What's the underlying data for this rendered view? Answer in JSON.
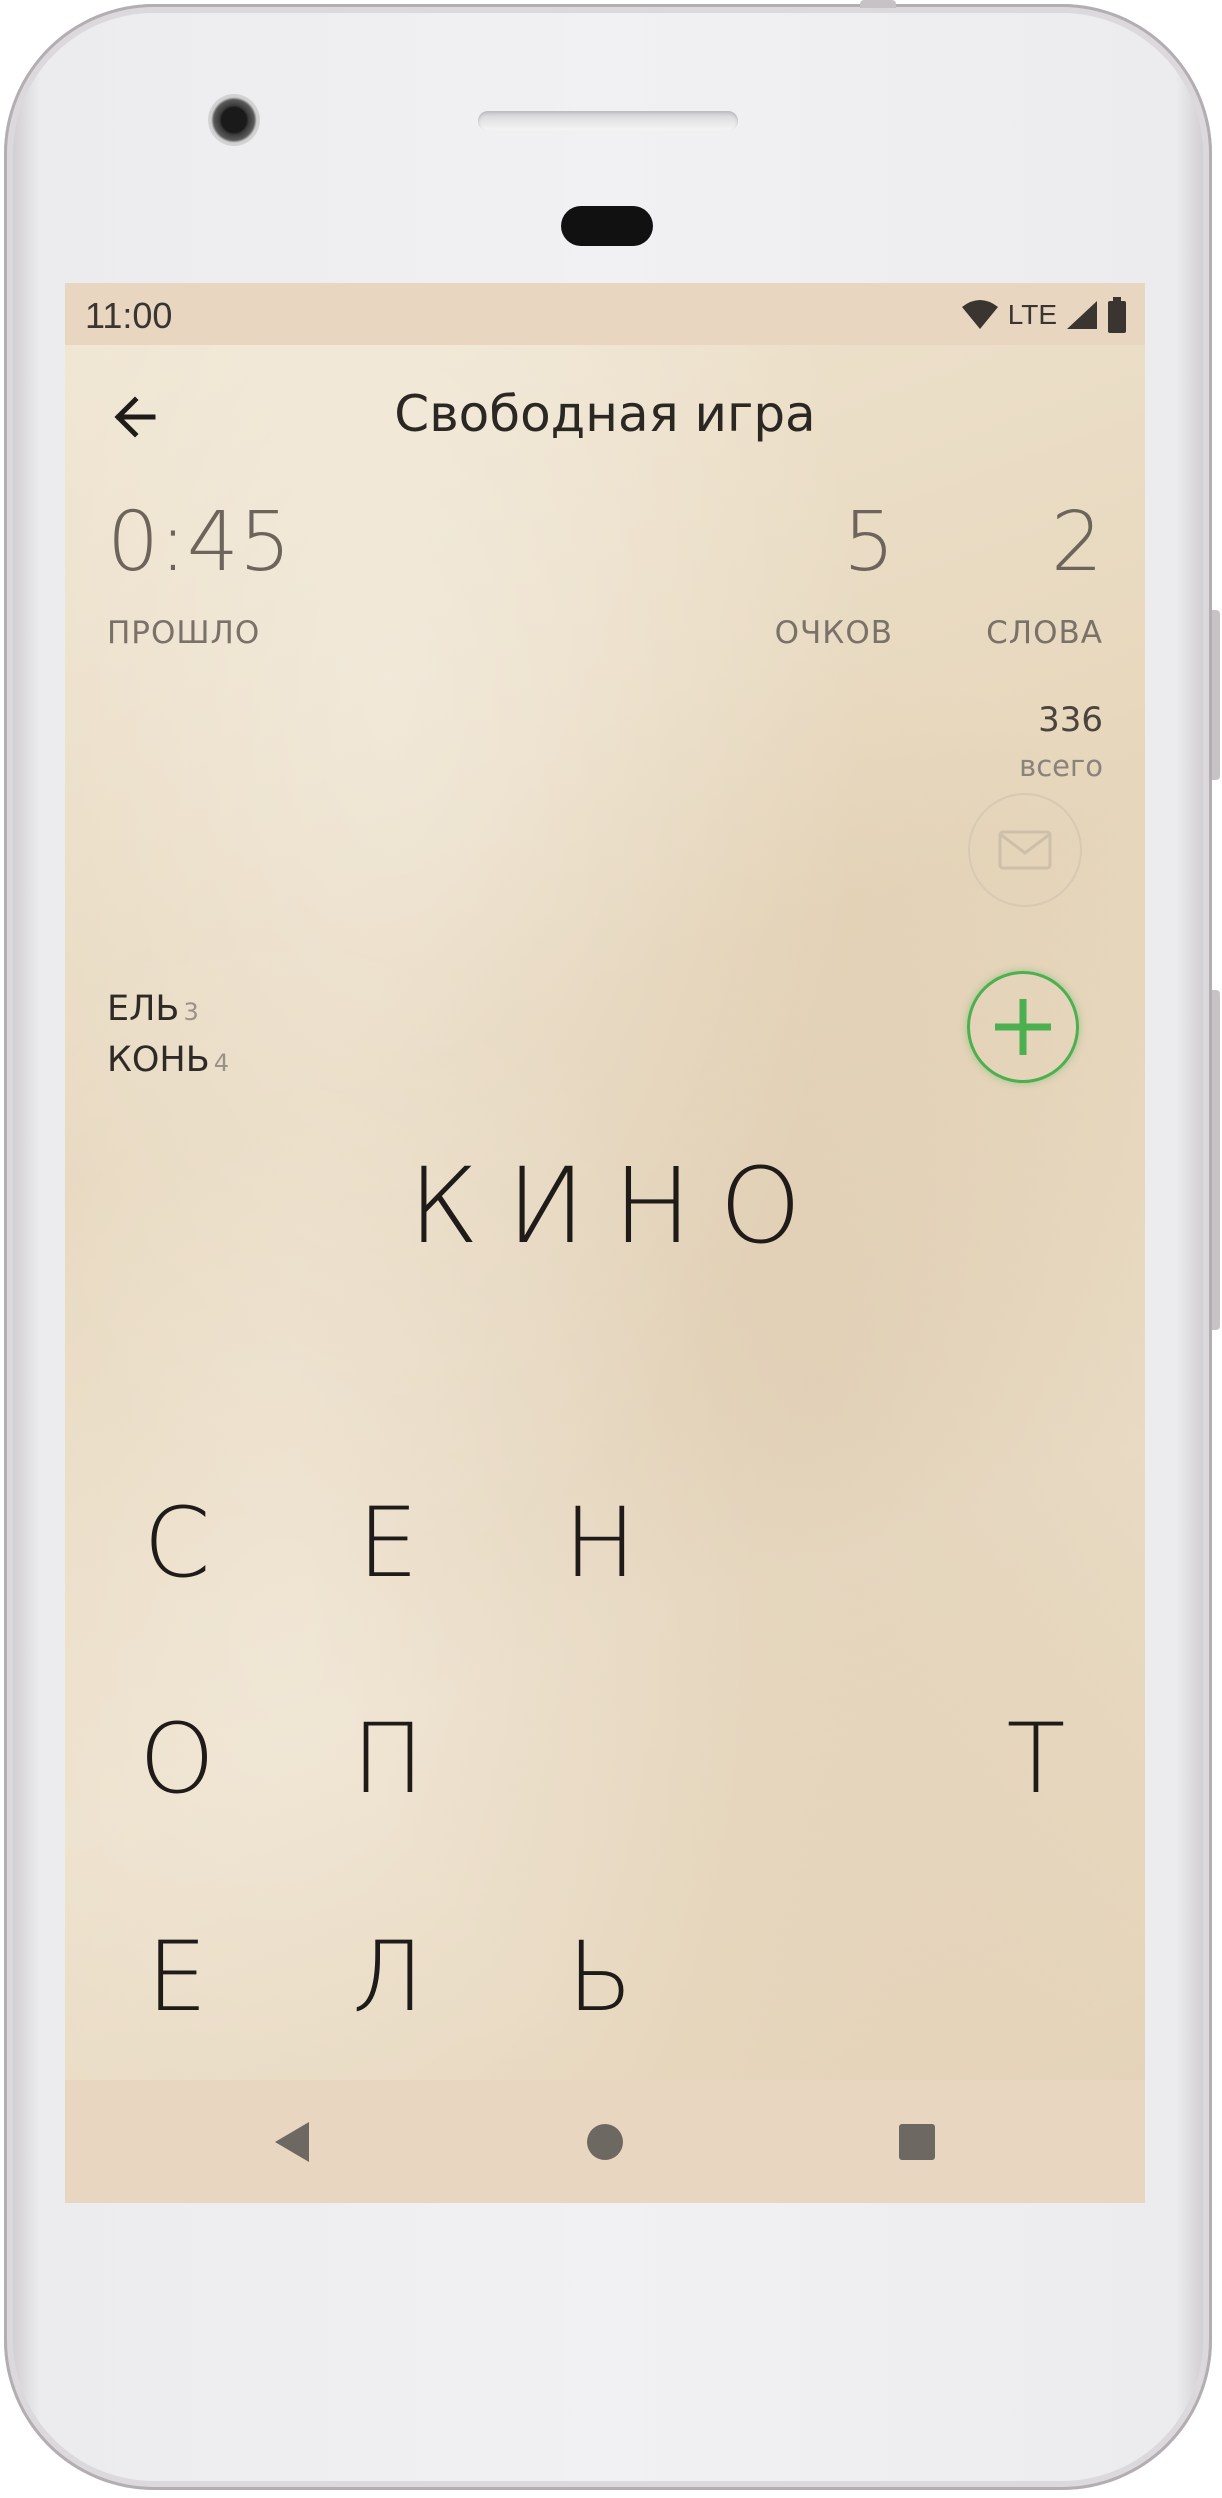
{
  "status_bar": {
    "time": "11:00",
    "network": "LTE"
  },
  "header": {
    "title": "Свободная игра"
  },
  "stats": {
    "elapsed": {
      "value": "0:45",
      "label": "ПРОШЛО"
    },
    "points": {
      "value": "5",
      "label": "ОЧКОВ"
    },
    "words": {
      "value": "2",
      "label": "СЛОВА"
    },
    "total": {
      "value": "336",
      "label": "всего"
    }
  },
  "found_words": [
    {
      "word": "ЕЛЬ",
      "points": "3"
    },
    {
      "word": "КОНЬ",
      "points": "4"
    }
  ],
  "current_word": "КИНО",
  "letter_grid": [
    [
      "С",
      "Е",
      "Н",
      "",
      ""
    ],
    [
      "О",
      "П",
      "",
      "",
      "Т"
    ],
    [
      "Е",
      "Л",
      "Ь",
      "",
      ""
    ]
  ],
  "icons": {
    "back": "arrow-left-icon",
    "mail": "envelope-icon",
    "add": "plus-icon",
    "nav_back": "triangle-back-icon",
    "nav_home": "circle-home-icon",
    "nav_recents": "square-recents-icon"
  },
  "colors": {
    "accent": "#4caf50",
    "background": "#ecdcc4",
    "text": "#1f1b18"
  }
}
